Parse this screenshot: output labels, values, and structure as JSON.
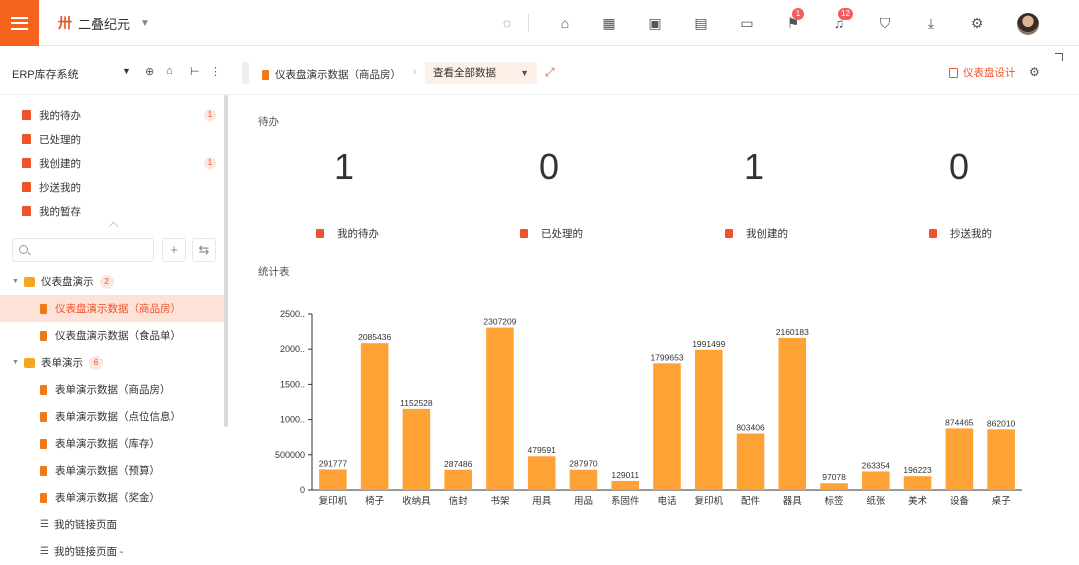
{
  "topbar": {
    "brand_title": "二叠纪元",
    "icons": [
      {
        "name": "refresh-icon",
        "badge": ""
      },
      {
        "name": "home-icon",
        "badge": ""
      },
      {
        "name": "app-grid-icon",
        "badge": ""
      },
      {
        "name": "image-icon",
        "badge": ""
      },
      {
        "name": "chart-icon",
        "badge": ""
      },
      {
        "name": "window-icon",
        "badge": ""
      },
      {
        "name": "flag-icon",
        "badge": "1"
      },
      {
        "name": "bell-icon",
        "badge": "12"
      },
      {
        "name": "shirt-icon",
        "badge": ""
      },
      {
        "name": "download-icon",
        "badge": ""
      },
      {
        "name": "settings-icon",
        "badge": ""
      }
    ]
  },
  "sidebar": {
    "system_title": "ERP库存系统",
    "quick_items": [
      {
        "label": "我的待办",
        "count": "1"
      },
      {
        "label": "已处理的",
        "count": ""
      },
      {
        "label": "我创建的",
        "count": "1"
      },
      {
        "label": "抄送我的",
        "count": ""
      },
      {
        "label": "我的暂存",
        "count": ""
      }
    ],
    "search_placeholder": "",
    "tree": {
      "group1": {
        "label": "仪表盘演示",
        "count": "2"
      },
      "group1_items": [
        "仪表盘演示数据（商品房）",
        "仪表盘演示数据（食品单）"
      ],
      "group2": {
        "label": "表单演示",
        "count": "6"
      },
      "group2_items": [
        "表单演示数据（商品房）",
        "表单演示数据（点位信息）",
        "表单演示数据（库存）",
        "表单演示数据（预算）",
        "表单演示数据（奖金）"
      ],
      "pages": [
        "我的链接页面",
        "我的链接页面 -"
      ]
    }
  },
  "content": {
    "breadcrumb": "仪表盘演示数据（商品房）",
    "view_select": "查看全部数据",
    "designer_label": "仪表盘设计",
    "todo_title": "待办",
    "stats": [
      {
        "value": "1",
        "label": "我的待办"
      },
      {
        "value": "0",
        "label": "已处理的"
      },
      {
        "value": "1",
        "label": "我创建的"
      },
      {
        "value": "0",
        "label": "抄送我的"
      }
    ],
    "chart_title": "统计表"
  },
  "colors": {
    "accent": "#f0522a",
    "bar": "#ffa235"
  },
  "chart_data": {
    "type": "bar",
    "title": "统计表",
    "categories": [
      "复印机",
      "椅子",
      "收纳具",
      "信封",
      "书架",
      "用具",
      "用品",
      "系固件",
      "电话",
      "复印机",
      "配件",
      "器具",
      "标签",
      "纸张",
      "美术",
      "设备",
      "桌子"
    ],
    "values": [
      291777,
      2085436,
      1152528,
      287486,
      2307209,
      479591,
      287970,
      129011,
      1799653,
      1991499,
      803406,
      2160183,
      97078,
      263354,
      196223,
      874465,
      862010
    ],
    "value_labels": [
      "291777",
      "2085436",
      "1152528",
      "287486",
      "2307209",
      "479591",
      "287970",
      "129011",
      "1799653",
      "1991499",
      "803406",
      "2160183",
      "97078",
      "263354",
      "196223",
      "874465",
      "862010"
    ],
    "y_ticks": [
      "0",
      "500000",
      "1000..",
      "1500..",
      "2000..",
      "2500.."
    ],
    "ylim": [
      0,
      2500000
    ],
    "grid": false
  }
}
